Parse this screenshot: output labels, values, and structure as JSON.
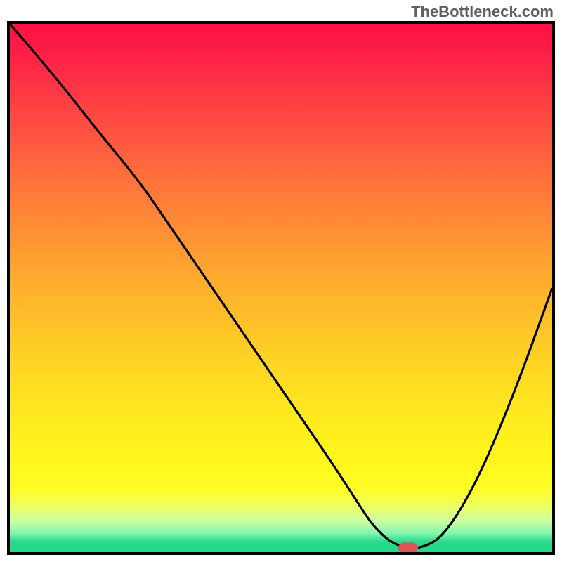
{
  "watermark": "TheBottleneck.com",
  "chart_data": {
    "type": "line",
    "title": "",
    "xlabel": "",
    "ylabel": "",
    "xlim": [
      0,
      100
    ],
    "ylim": [
      0,
      100
    ],
    "series": [
      {
        "name": "curve",
        "x": [
          0,
          8,
          16,
          24,
          28,
          36,
          44,
          52,
          60,
          65,
          67,
          70,
          73,
          76,
          80,
          86,
          93,
          100
        ],
        "y": [
          100,
          90.5,
          80,
          70,
          64,
          52,
          40,
          28,
          16,
          8,
          5,
          2,
          0.8,
          0.8,
          3,
          13,
          30,
          50
        ]
      }
    ],
    "marker": {
      "x": 73.5,
      "y": 0.8
    },
    "background_gradient": {
      "top": "#ff1145",
      "middle": "#ffd424",
      "bottom": "#22d98a"
    }
  }
}
